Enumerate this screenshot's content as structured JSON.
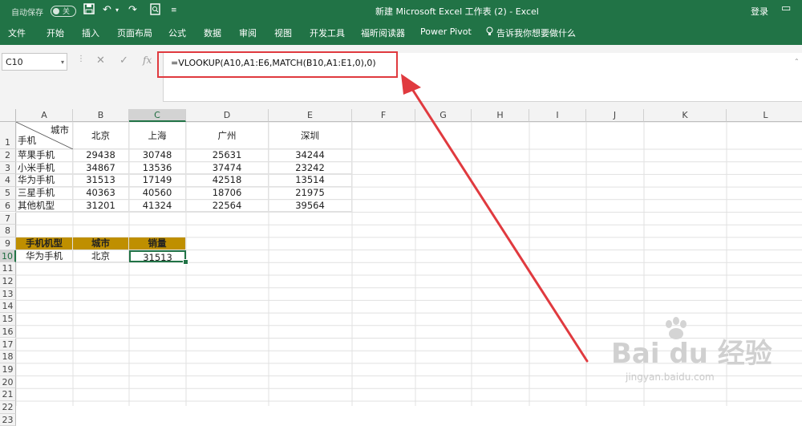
{
  "titlebar": {
    "autosave_label": "自动保存",
    "autosave_state": "关",
    "title": "新建 Microsoft Excel 工作表 (2)  -  Excel",
    "login": "登录"
  },
  "quick_access": {
    "save_icon": "save-icon",
    "undo_icon": "undo-icon",
    "redo_icon": "redo-icon",
    "preview_icon": "print-preview-icon",
    "customize_icon": "customize-icon"
  },
  "ribbon_tabs": [
    "文件",
    "开始",
    "插入",
    "页面布局",
    "公式",
    "数据",
    "审阅",
    "视图",
    "开发工具",
    "福昕阅读器",
    "Power Pivot"
  ],
  "tell_me": "告诉我你想要做什么",
  "namebox": "C10",
  "formula_buttons": {
    "cancel": "✕",
    "enter": "✓",
    "fx": "fx"
  },
  "formula": "=VLOOKUP(A10,A1:E6,MATCH(B10,A1:E1,0),0)",
  "columns": [
    "A",
    "B",
    "C",
    "D",
    "E",
    "F",
    "G",
    "H",
    "I",
    "J",
    "K",
    "L"
  ],
  "rows": [
    "1",
    "2",
    "3",
    "4",
    "5",
    "6",
    "7",
    "8",
    "9",
    "10",
    "11",
    "12",
    "13",
    "14",
    "15",
    "16",
    "17",
    "18",
    "19",
    "20",
    "21",
    "22",
    "23"
  ],
  "selected_cell": {
    "column": "C",
    "row": "10"
  },
  "header_row": {
    "a1_top": "城市",
    "a1_bottom": "手机",
    "cities": [
      "北京",
      "上海",
      "广州",
      "深圳"
    ]
  },
  "table_rows": [
    {
      "phone": "苹果手机",
      "values": [
        "29438",
        "30748",
        "25631",
        "34244"
      ]
    },
    {
      "phone": "小米手机",
      "values": [
        "34867",
        "13536",
        "37474",
        "23242"
      ]
    },
    {
      "phone": "华为手机",
      "values": [
        "31513",
        "17149",
        "42518",
        "13514"
      ]
    },
    {
      "phone": "三星手机",
      "values": [
        "40363",
        "40560",
        "18706",
        "21975"
      ]
    },
    {
      "phone": "其他机型",
      "values": [
        "31201",
        "41324",
        "22564",
        "39564"
      ]
    }
  ],
  "lookup": {
    "headers": [
      "手机机型",
      "城市",
      "销量"
    ],
    "values": [
      "华为手机",
      "北京",
      "31513"
    ],
    "header_color": "#bf8f00"
  },
  "watermark": {
    "brand": "Bai du 经验",
    "url": "jingyan.baidu.com"
  },
  "accent_color": "#217346",
  "annotation_color": "#e03a3f"
}
